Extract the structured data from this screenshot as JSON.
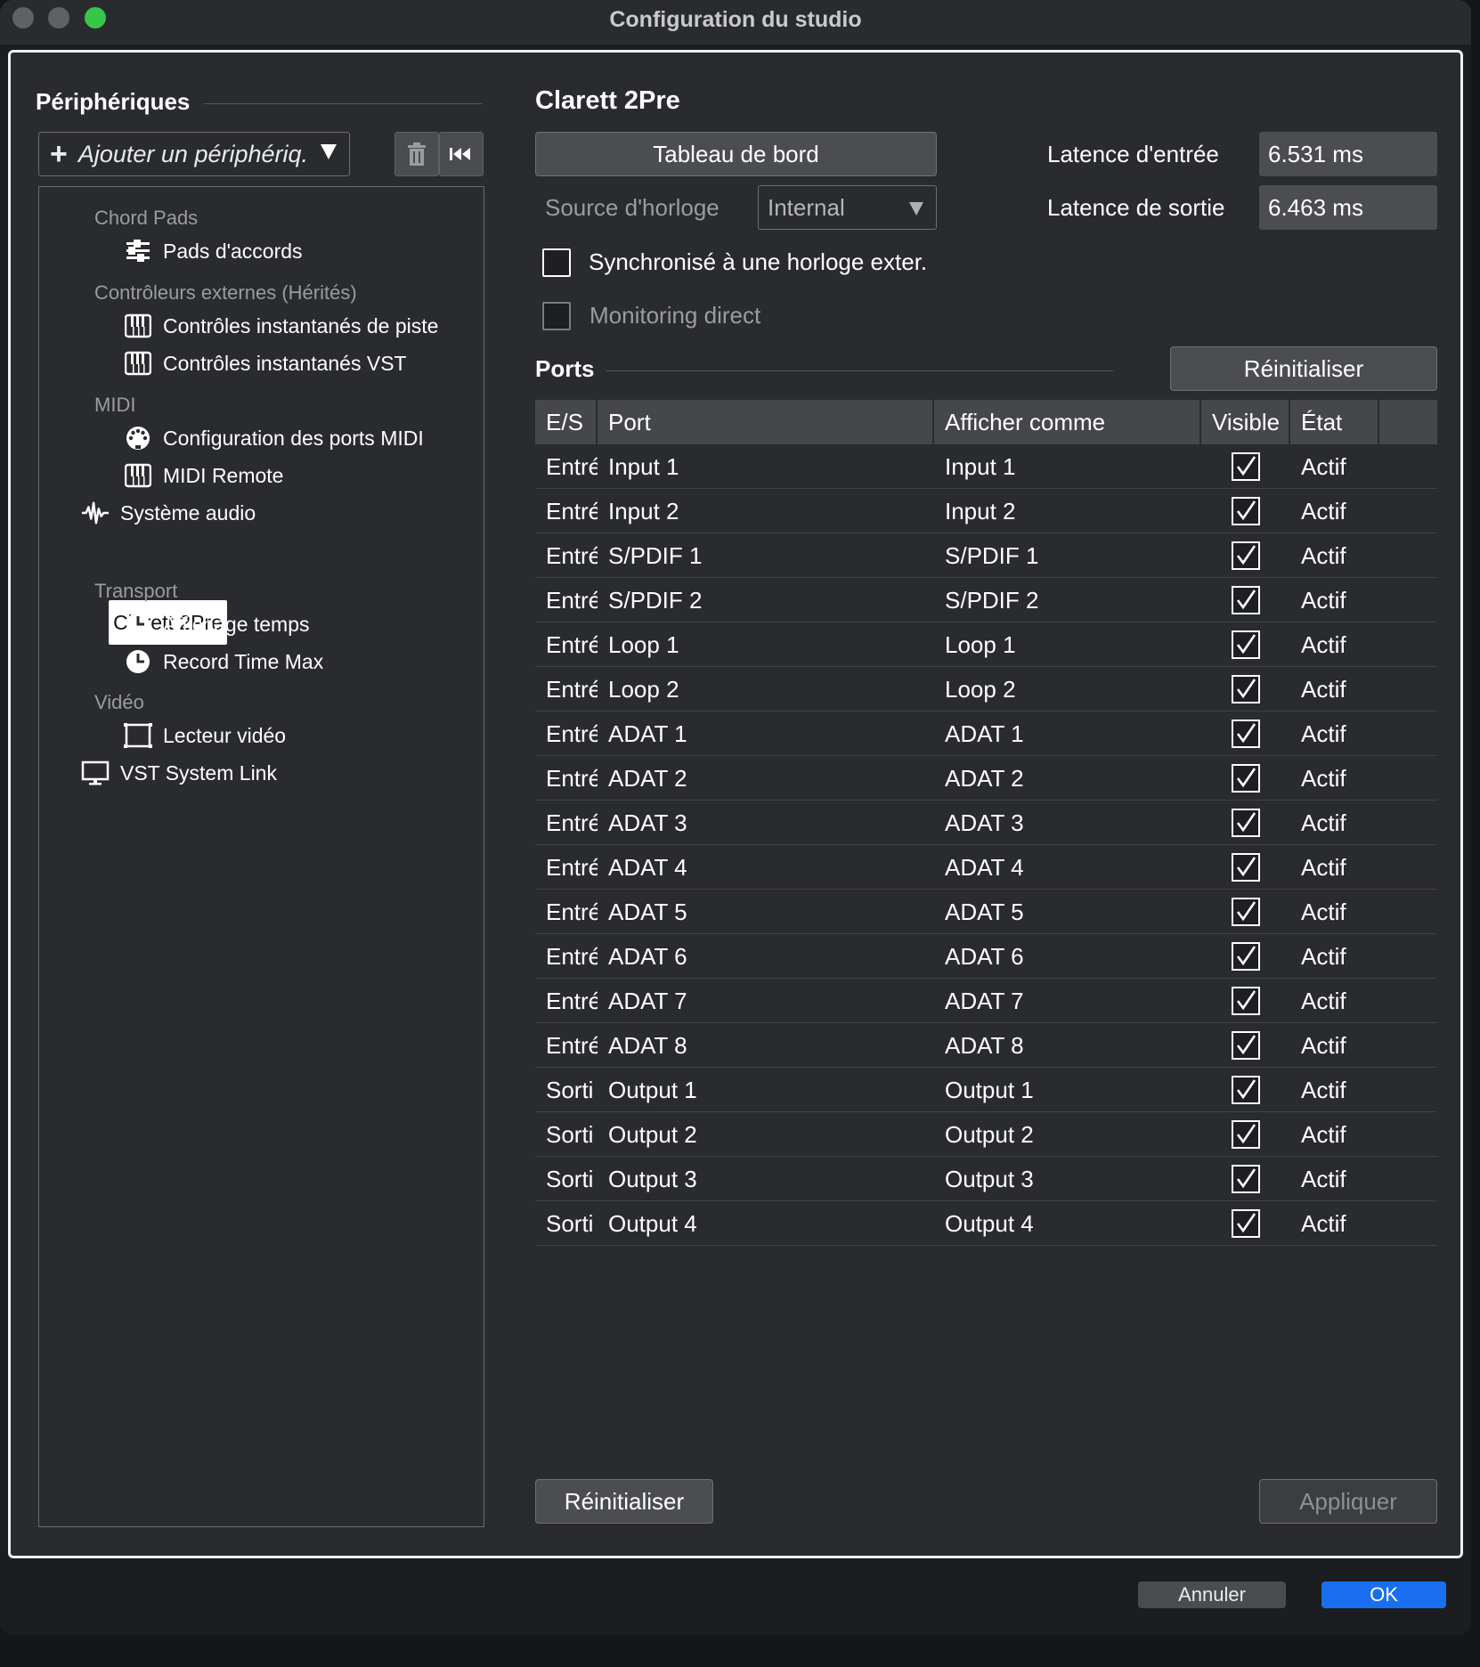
{
  "window": {
    "title": "Configuration du studio",
    "accent_green": "#36c748",
    "ok_blue": "#1a6ff0"
  },
  "devices": {
    "title": "Périphériques",
    "add_label": "Ajouter un périphériq.",
    "tree": {
      "chord_pads": "Chord Pads",
      "pads_accords": "Pads d'accords",
      "controleurs": "Contrôleurs externes (Hérités)",
      "controles_piste": "Contrôles instantanés de piste",
      "controles_vst": "Contrôles instantanés VST",
      "midi": "MIDI",
      "config_ports_midi": "Configuration des ports MIDI",
      "midi_remote": "MIDI Remote",
      "systeme_audio": "Système audio",
      "clarett": "Clarett 2Pre",
      "transport": "Transport",
      "affichage_temps": "Affichage temps",
      "record_time_max": "Record Time Max",
      "video": "Vidéo",
      "lecteur_video": "Lecteur vidéo",
      "vst_system_link": "VST System Link"
    }
  },
  "detail": {
    "title": "Clarett 2Pre",
    "dashboard_label": "Tableau de bord",
    "input_latency_label": "Latence d'entrée",
    "input_latency_value": "6.531 ms",
    "output_latency_label": "Latence de sortie",
    "output_latency_value": "6.463 ms",
    "clock_source_label": "Source d'horloge",
    "clock_source_value": "Internal",
    "sync_label": "Synchronisé à une horloge exter.",
    "monitoring_label": "Monitoring direct",
    "ports_title": "Ports",
    "reset_top_label": "Réinitialiser",
    "reset_bottom_label": "Réinitialiser",
    "apply_label": "Appliquer"
  },
  "ports_table": {
    "headers": {
      "es": "E/S",
      "port": "Port",
      "afficher": "Afficher comme",
      "visible": "Visible",
      "etat": "État"
    },
    "rows": [
      {
        "es": "Entré",
        "port": "Input 1",
        "afficher": "Input 1",
        "etat": "Actif"
      },
      {
        "es": "Entré",
        "port": "Input 2",
        "afficher": "Input 2",
        "etat": "Actif"
      },
      {
        "es": "Entré",
        "port": "S/PDIF 1",
        "afficher": "S/PDIF 1",
        "etat": "Actif"
      },
      {
        "es": "Entré",
        "port": "S/PDIF 2",
        "afficher": "S/PDIF 2",
        "etat": "Actif"
      },
      {
        "es": "Entré",
        "port": "Loop 1",
        "afficher": "Loop 1",
        "etat": "Actif"
      },
      {
        "es": "Entré",
        "port": "Loop 2",
        "afficher": "Loop 2",
        "etat": "Actif"
      },
      {
        "es": "Entré",
        "port": "ADAT 1",
        "afficher": "ADAT 1",
        "etat": "Actif"
      },
      {
        "es": "Entré",
        "port": "ADAT 2",
        "afficher": "ADAT 2",
        "etat": "Actif"
      },
      {
        "es": "Entré",
        "port": "ADAT 3",
        "afficher": "ADAT 3",
        "etat": "Actif"
      },
      {
        "es": "Entré",
        "port": "ADAT 4",
        "afficher": "ADAT 4",
        "etat": "Actif"
      },
      {
        "es": "Entré",
        "port": "ADAT 5",
        "afficher": "ADAT 5",
        "etat": "Actif"
      },
      {
        "es": "Entré",
        "port": "ADAT 6",
        "afficher": "ADAT 6",
        "etat": "Actif"
      },
      {
        "es": "Entré",
        "port": "ADAT 7",
        "afficher": "ADAT 7",
        "etat": "Actif"
      },
      {
        "es": "Entré",
        "port": "ADAT 8",
        "afficher": "ADAT 8",
        "etat": "Actif"
      },
      {
        "es": "Sorti",
        "port": "Output 1",
        "afficher": "Output 1",
        "etat": "Actif"
      },
      {
        "es": "Sorti",
        "port": "Output 2",
        "afficher": "Output 2",
        "etat": "Actif"
      },
      {
        "es": "Sorti",
        "port": "Output 3",
        "afficher": "Output 3",
        "etat": "Actif"
      },
      {
        "es": "Sorti",
        "port": "Output 4",
        "afficher": "Output 4",
        "etat": "Actif"
      }
    ]
  },
  "footer": {
    "cancel_label": "Annuler",
    "ok_label": "OK"
  }
}
